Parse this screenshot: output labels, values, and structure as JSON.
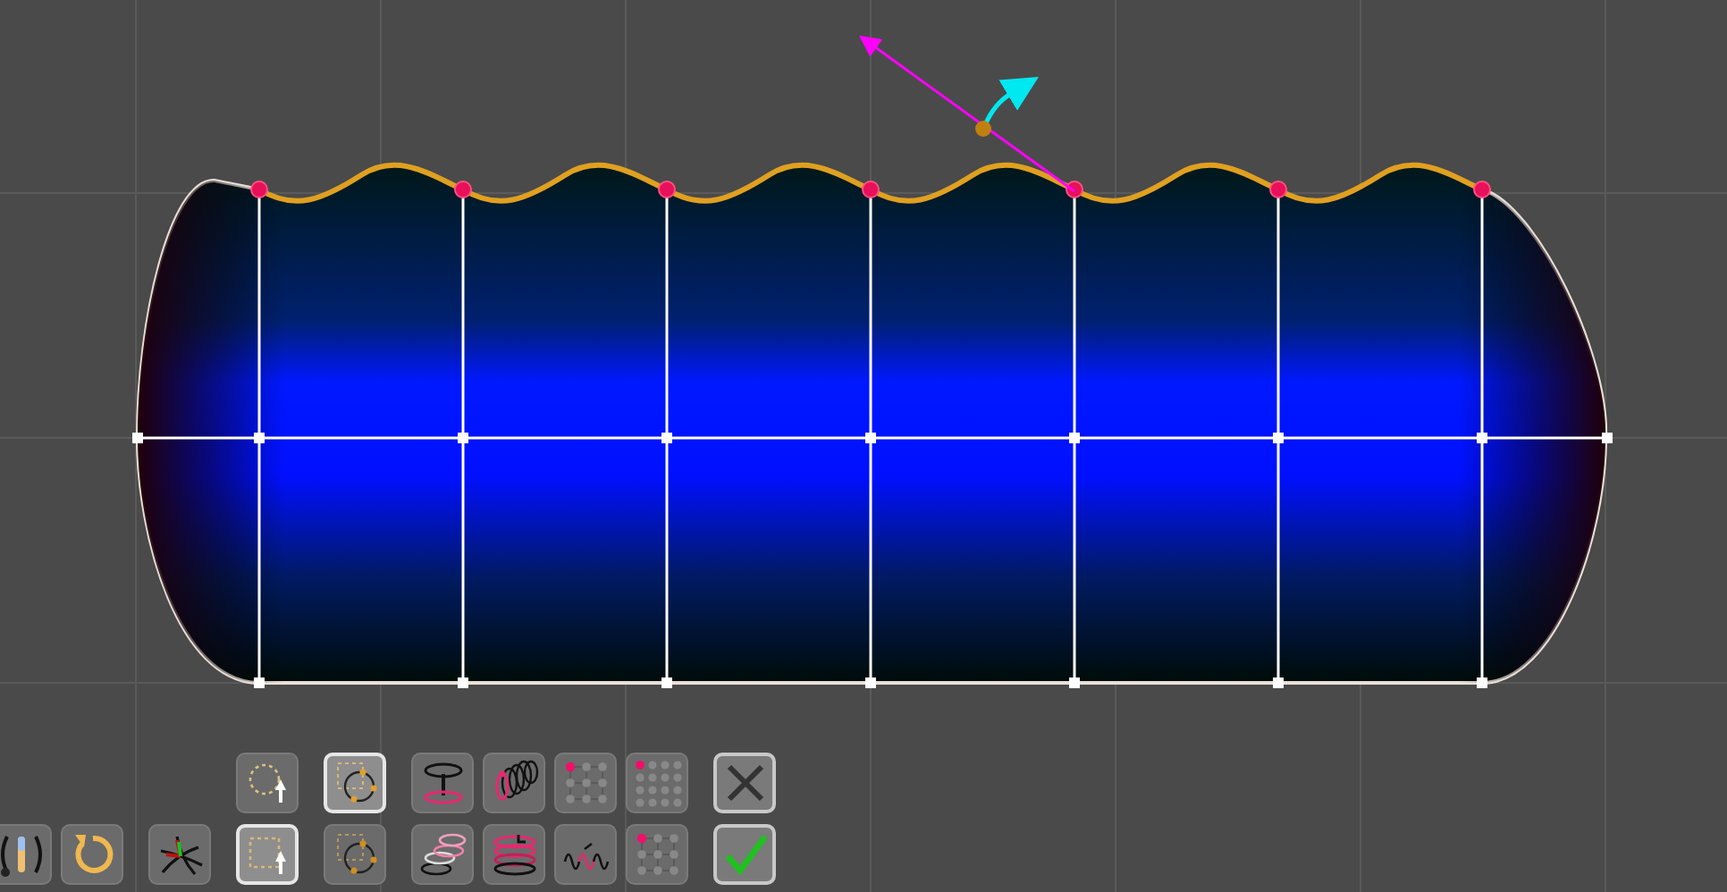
{
  "toolbar": {
    "groups": [
      [
        [
          {
            "kind": "slider",
            "selected": false
          }
        ],
        [
          {
            "kind": "rotate",
            "selected": false
          }
        ]
      ],
      [
        [
          {
            "kind": "axes",
            "selected": false
          }
        ]
      ],
      [
        [
          {
            "kind": "circle-select",
            "selected": false
          },
          {
            "kind": "rect-select",
            "selected": true
          }
        ]
      ],
      [
        [
          {
            "kind": "circle-points-rect",
            "selected": true
          },
          {
            "kind": "circle-points",
            "selected": false
          }
        ]
      ],
      [
        [
          {
            "kind": "extrude",
            "selected": false
          },
          {
            "kind": "stack",
            "selected": false
          }
        ],
        [
          {
            "kind": "coil",
            "selected": false
          },
          {
            "kind": "rings",
            "selected": false
          }
        ],
        [
          {
            "kind": "grid3",
            "selected": false
          },
          {
            "kind": "wave",
            "selected": false
          }
        ],
        [
          {
            "kind": "grid4",
            "selected": false
          },
          {
            "kind": "grid3",
            "selected": false
          }
        ]
      ],
      [
        [
          {
            "kind": "cancel",
            "selected": false
          },
          {
            "kind": "confirm",
            "selected": false
          }
        ]
      ]
    ]
  }
}
